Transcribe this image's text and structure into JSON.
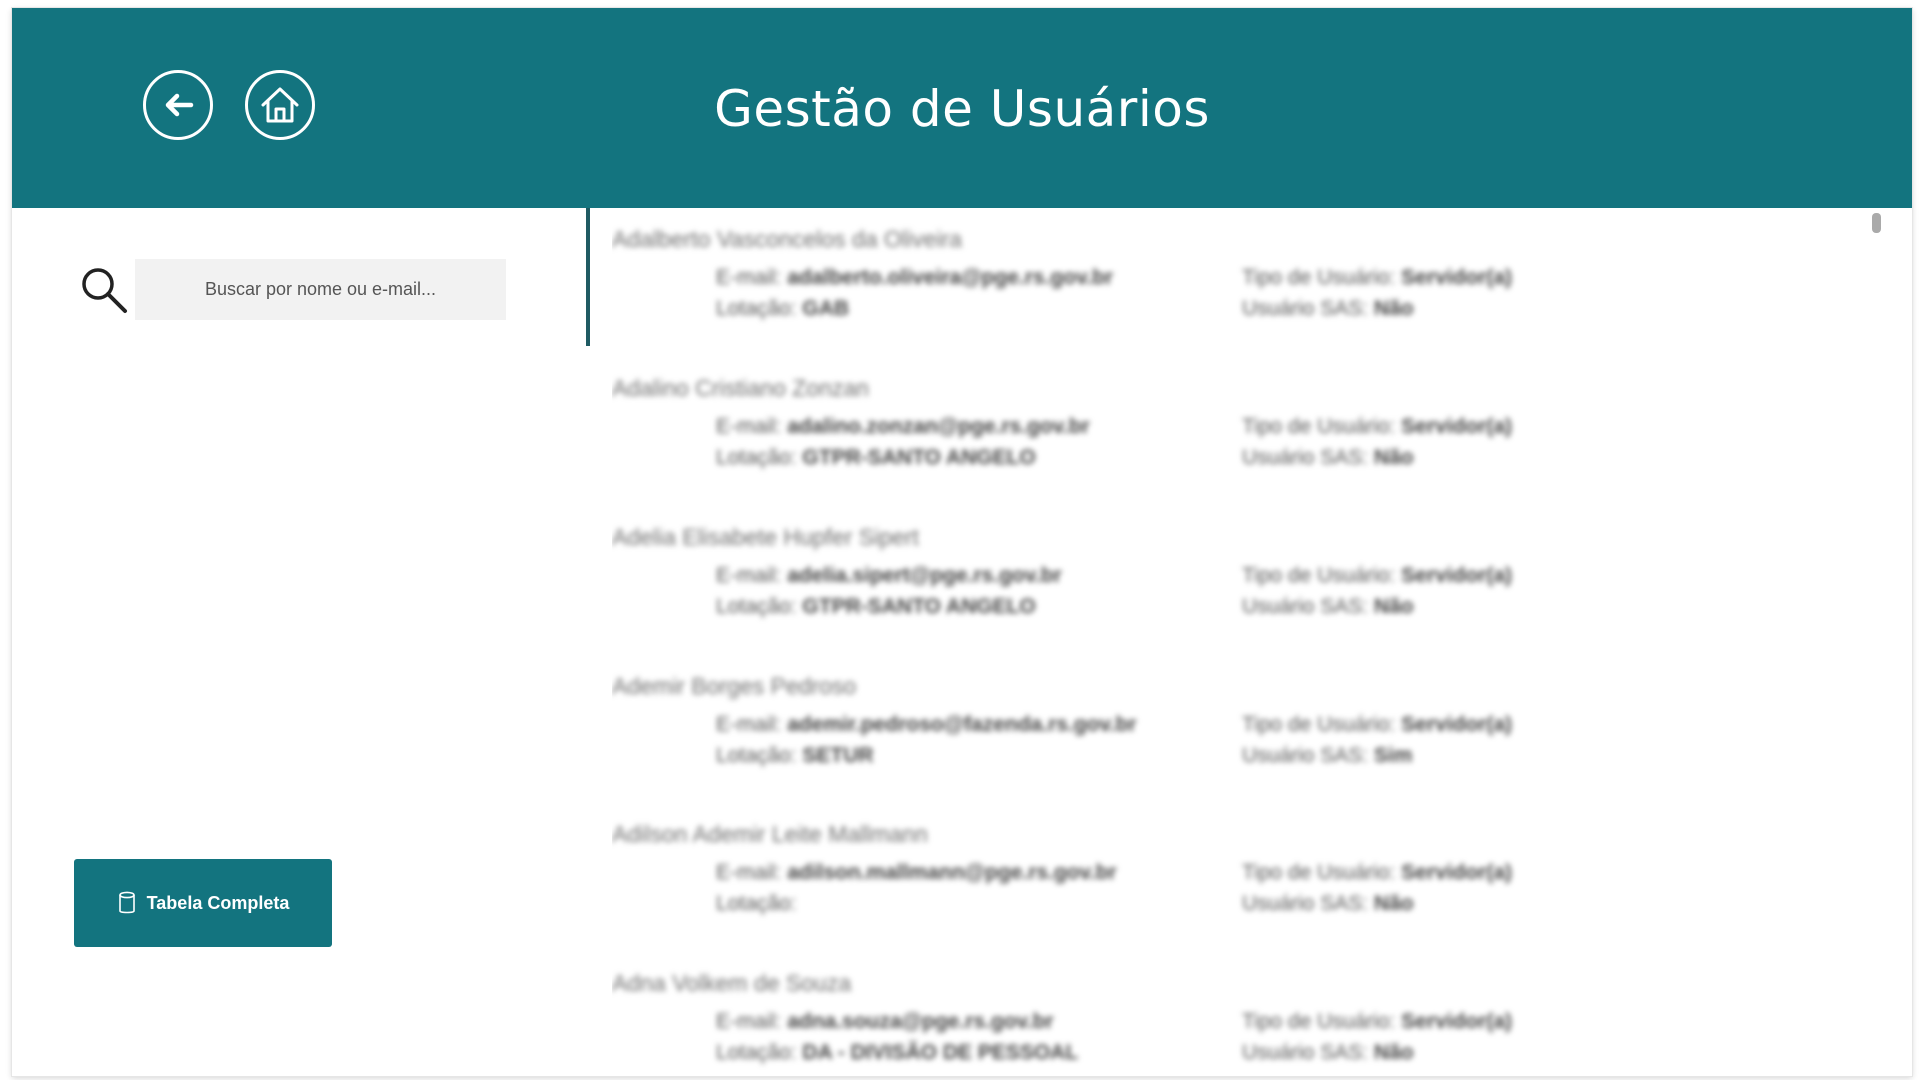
{
  "header": {
    "title": "Gestão de Usuários",
    "background_color": "#13747f",
    "back_icon": "arrow-left-icon",
    "home_icon": "home-icon"
  },
  "search": {
    "placeholder": "Buscar por nome ou e-mail...",
    "value": "",
    "icon": "search-icon"
  },
  "actions": {
    "full_table_label": "Tabela Completa",
    "full_table_icon": "database-icon"
  },
  "users": [
    {
      "name": "Adalberto Vasconcelos da Oliveira",
      "email_label": "E-mail:",
      "email": "adalberto.oliveira@pge.rs.gov.br",
      "lotacao_label": "Lotação:",
      "lotacao": "GAB",
      "tipo_label": "Tipo de Usuário:",
      "tipo": "Servidor(a)",
      "sas_label": "Usuário SAS:",
      "sas": "Não"
    },
    {
      "name": "Adalino Cristiano Zonzan",
      "email_label": "E-mail:",
      "email": "adalino.zonzan@pge.rs.gov.br",
      "lotacao_label": "Lotação:",
      "lotacao": "GTPR-SANTO ANGELO",
      "tipo_label": "Tipo de Usuário:",
      "tipo": "Servidor(a)",
      "sas_label": "Usuário SAS:",
      "sas": "Não"
    },
    {
      "name": "Adelia Elisabete Hupfer Sipert",
      "email_label": "E-mail:",
      "email": "adelia.sipert@pge.rs.gov.br",
      "lotacao_label": "Lotação:",
      "lotacao": "GTPR-SANTO ANGELO",
      "tipo_label": "Tipo de Usuário:",
      "tipo": "Servidor(a)",
      "sas_label": "Usuário SAS:",
      "sas": "Não"
    },
    {
      "name": "Ademir Borges Pedroso",
      "email_label": "E-mail:",
      "email": "ademir.pedroso@fazenda.rs.gov.br",
      "lotacao_label": "Lotação:",
      "lotacao": "SETUR",
      "tipo_label": "Tipo de Usuário:",
      "tipo": "Servidor(a)",
      "sas_label": "Usuário SAS:",
      "sas": "Sim"
    },
    {
      "name": "Adilson Ademir Leite Mallmann",
      "email_label": "E-mail:",
      "email": "adilson.mallmann@pge.rs.gov.br",
      "lotacao_label": "Lotação:",
      "lotacao": "",
      "tipo_label": "Tipo de Usuário:",
      "tipo": "Servidor(a)",
      "sas_label": "Usuário SAS:",
      "sas": "Não"
    },
    {
      "name": "Adna Volkem de Souza",
      "email_label": "E-mail:",
      "email": "adna.souza@pge.rs.gov.br",
      "lotacao_label": "Lotação:",
      "lotacao": "DA - DIVISÃO DE PESSOAL",
      "tipo_label": "Tipo de Usuário:",
      "tipo": "Servidor(a)",
      "sas_label": "Usuário SAS:",
      "sas": "Não"
    }
  ]
}
